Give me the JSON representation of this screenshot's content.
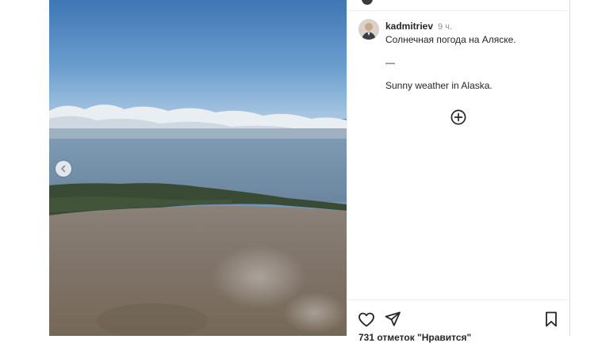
{
  "post": {
    "username": "kadmitriev",
    "time_ago": "9 ч.",
    "caption_ru": "Солнечная погода на Аляске.",
    "caption_separator": "—",
    "caption_en": "Sunny weather in Alaska.",
    "likes_text": "731 отметок \"Нравится\""
  },
  "icons": {
    "prev": "chevron-left-icon",
    "more_replies": "plus-circle-icon",
    "like": "heart-icon",
    "share": "paper-plane-icon",
    "save": "bookmark-icon"
  },
  "colors": {
    "text": "#262626",
    "secondary": "#8e8e8e",
    "divider": "#efefef"
  }
}
